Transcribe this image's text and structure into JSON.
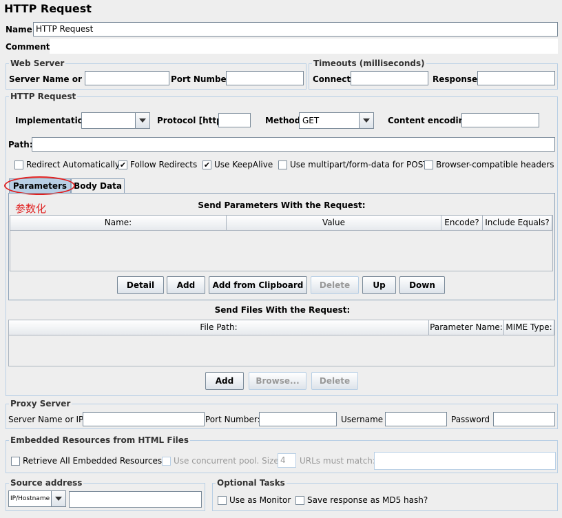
{
  "title": "HTTP Request",
  "name_label": "Name:",
  "name_value": "HTTP Request",
  "comments_label": "Comments:",
  "web_server": {
    "legend": "Web Server",
    "server_label": "Server Name or IP:",
    "port_label": "Port Number:"
  },
  "timeouts": {
    "legend": "Timeouts (milliseconds)",
    "connect_label": "Connect:",
    "response_label": "Response:"
  },
  "http_request": {
    "legend": "HTTP Request",
    "implementation_label": "Implementation:",
    "implementation_value": "",
    "protocol_label": "Protocol [http]:",
    "method_label": "Method:",
    "method_value": "GET",
    "encoding_label": "Content encoding:",
    "path_label": "Path:",
    "checkboxes": [
      {
        "label": "Redirect Automatically",
        "checked": false
      },
      {
        "label": "Follow Redirects",
        "checked": true
      },
      {
        "label": "Use KeepAlive",
        "checked": true
      },
      {
        "label": "Use multipart/form-data for POST",
        "checked": false
      },
      {
        "label": "Browser-compatible headers",
        "checked": false
      }
    ]
  },
  "tabs": [
    "Parameters",
    "Body Data"
  ],
  "annotation_text": "参数化",
  "params": {
    "heading": "Send Parameters With the Request:",
    "columns": [
      "Name:",
      "Value",
      "Encode?",
      "Include Equals?"
    ],
    "buttons": [
      {
        "label": "Detail",
        "enabled": true
      },
      {
        "label": "Add",
        "enabled": true
      },
      {
        "label": "Add from Clipboard",
        "enabled": true
      },
      {
        "label": "Delete",
        "enabled": false
      },
      {
        "label": "Up",
        "enabled": true
      },
      {
        "label": "Down",
        "enabled": true
      }
    ]
  },
  "files": {
    "heading": "Send Files With the Request:",
    "columns": [
      "File Path:",
      "Parameter Name:",
      "MIME Type:"
    ],
    "buttons": [
      {
        "label": "Add",
        "enabled": true
      },
      {
        "label": "Browse...",
        "enabled": false
      },
      {
        "label": "Delete",
        "enabled": false
      }
    ]
  },
  "proxy": {
    "legend": "Proxy Server",
    "server_label": "Server Name or IP:",
    "port_label": "Port Number:",
    "username_label": "Username",
    "password_label": "Password"
  },
  "embedded": {
    "legend": "Embedded Resources from HTML Files",
    "retrieve_label": "Retrieve All Embedded Resources",
    "pool_label": "Use concurrent pool. Size:",
    "pool_value": "4",
    "urls_label": "URLs must match:"
  },
  "source": {
    "legend": "Source address",
    "type_value": "IP/Hostname"
  },
  "optional": {
    "legend": "Optional Tasks",
    "monitor_label": "Use as Monitor",
    "md5_label": "Save response as MD5 hash?"
  },
  "colors": {
    "background": "#eeeeee",
    "border": "#b8cfe5",
    "annotation": "#e02020"
  }
}
